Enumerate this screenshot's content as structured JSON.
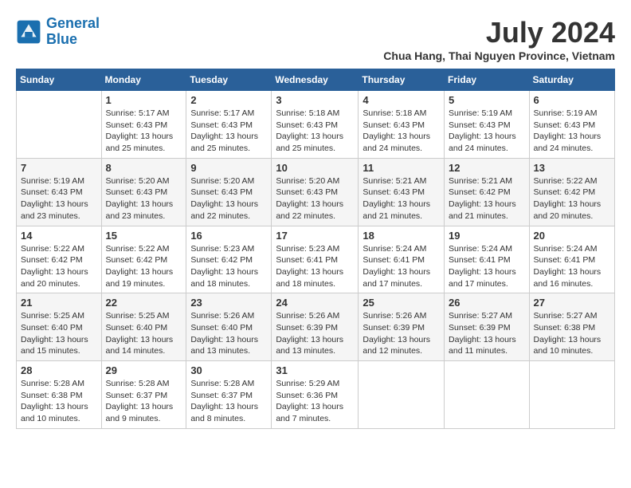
{
  "header": {
    "logo_line1": "General",
    "logo_line2": "Blue",
    "month_year": "July 2024",
    "location": "Chua Hang, Thai Nguyen Province, Vietnam"
  },
  "days_of_week": [
    "Sunday",
    "Monday",
    "Tuesday",
    "Wednesday",
    "Thursday",
    "Friday",
    "Saturday"
  ],
  "weeks": [
    [
      {
        "day": "",
        "info": ""
      },
      {
        "day": "1",
        "info": "Sunrise: 5:17 AM\nSunset: 6:43 PM\nDaylight: 13 hours\nand 25 minutes."
      },
      {
        "day": "2",
        "info": "Sunrise: 5:17 AM\nSunset: 6:43 PM\nDaylight: 13 hours\nand 25 minutes."
      },
      {
        "day": "3",
        "info": "Sunrise: 5:18 AM\nSunset: 6:43 PM\nDaylight: 13 hours\nand 25 minutes."
      },
      {
        "day": "4",
        "info": "Sunrise: 5:18 AM\nSunset: 6:43 PM\nDaylight: 13 hours\nand 24 minutes."
      },
      {
        "day": "5",
        "info": "Sunrise: 5:19 AM\nSunset: 6:43 PM\nDaylight: 13 hours\nand 24 minutes."
      },
      {
        "day": "6",
        "info": "Sunrise: 5:19 AM\nSunset: 6:43 PM\nDaylight: 13 hours\nand 24 minutes."
      }
    ],
    [
      {
        "day": "7",
        "info": "Sunrise: 5:19 AM\nSunset: 6:43 PM\nDaylight: 13 hours\nand 23 minutes."
      },
      {
        "day": "8",
        "info": "Sunrise: 5:20 AM\nSunset: 6:43 PM\nDaylight: 13 hours\nand 23 minutes."
      },
      {
        "day": "9",
        "info": "Sunrise: 5:20 AM\nSunset: 6:43 PM\nDaylight: 13 hours\nand 22 minutes."
      },
      {
        "day": "10",
        "info": "Sunrise: 5:20 AM\nSunset: 6:43 PM\nDaylight: 13 hours\nand 22 minutes."
      },
      {
        "day": "11",
        "info": "Sunrise: 5:21 AM\nSunset: 6:43 PM\nDaylight: 13 hours\nand 21 minutes."
      },
      {
        "day": "12",
        "info": "Sunrise: 5:21 AM\nSunset: 6:42 PM\nDaylight: 13 hours\nand 21 minutes."
      },
      {
        "day": "13",
        "info": "Sunrise: 5:22 AM\nSunset: 6:42 PM\nDaylight: 13 hours\nand 20 minutes."
      }
    ],
    [
      {
        "day": "14",
        "info": "Sunrise: 5:22 AM\nSunset: 6:42 PM\nDaylight: 13 hours\nand 20 minutes."
      },
      {
        "day": "15",
        "info": "Sunrise: 5:22 AM\nSunset: 6:42 PM\nDaylight: 13 hours\nand 19 minutes."
      },
      {
        "day": "16",
        "info": "Sunrise: 5:23 AM\nSunset: 6:42 PM\nDaylight: 13 hours\nand 18 minutes."
      },
      {
        "day": "17",
        "info": "Sunrise: 5:23 AM\nSunset: 6:41 PM\nDaylight: 13 hours\nand 18 minutes."
      },
      {
        "day": "18",
        "info": "Sunrise: 5:24 AM\nSunset: 6:41 PM\nDaylight: 13 hours\nand 17 minutes."
      },
      {
        "day": "19",
        "info": "Sunrise: 5:24 AM\nSunset: 6:41 PM\nDaylight: 13 hours\nand 17 minutes."
      },
      {
        "day": "20",
        "info": "Sunrise: 5:24 AM\nSunset: 6:41 PM\nDaylight: 13 hours\nand 16 minutes."
      }
    ],
    [
      {
        "day": "21",
        "info": "Sunrise: 5:25 AM\nSunset: 6:40 PM\nDaylight: 13 hours\nand 15 minutes."
      },
      {
        "day": "22",
        "info": "Sunrise: 5:25 AM\nSunset: 6:40 PM\nDaylight: 13 hours\nand 14 minutes."
      },
      {
        "day": "23",
        "info": "Sunrise: 5:26 AM\nSunset: 6:40 PM\nDaylight: 13 hours\nand 13 minutes."
      },
      {
        "day": "24",
        "info": "Sunrise: 5:26 AM\nSunset: 6:39 PM\nDaylight: 13 hours\nand 13 minutes."
      },
      {
        "day": "25",
        "info": "Sunrise: 5:26 AM\nSunset: 6:39 PM\nDaylight: 13 hours\nand 12 minutes."
      },
      {
        "day": "26",
        "info": "Sunrise: 5:27 AM\nSunset: 6:39 PM\nDaylight: 13 hours\nand 11 minutes."
      },
      {
        "day": "27",
        "info": "Sunrise: 5:27 AM\nSunset: 6:38 PM\nDaylight: 13 hours\nand 10 minutes."
      }
    ],
    [
      {
        "day": "28",
        "info": "Sunrise: 5:28 AM\nSunset: 6:38 PM\nDaylight: 13 hours\nand 10 minutes."
      },
      {
        "day": "29",
        "info": "Sunrise: 5:28 AM\nSunset: 6:37 PM\nDaylight: 13 hours\nand 9 minutes."
      },
      {
        "day": "30",
        "info": "Sunrise: 5:28 AM\nSunset: 6:37 PM\nDaylight: 13 hours\nand 8 minutes."
      },
      {
        "day": "31",
        "info": "Sunrise: 5:29 AM\nSunset: 6:36 PM\nDaylight: 13 hours\nand 7 minutes."
      },
      {
        "day": "",
        "info": ""
      },
      {
        "day": "",
        "info": ""
      },
      {
        "day": "",
        "info": ""
      }
    ]
  ]
}
